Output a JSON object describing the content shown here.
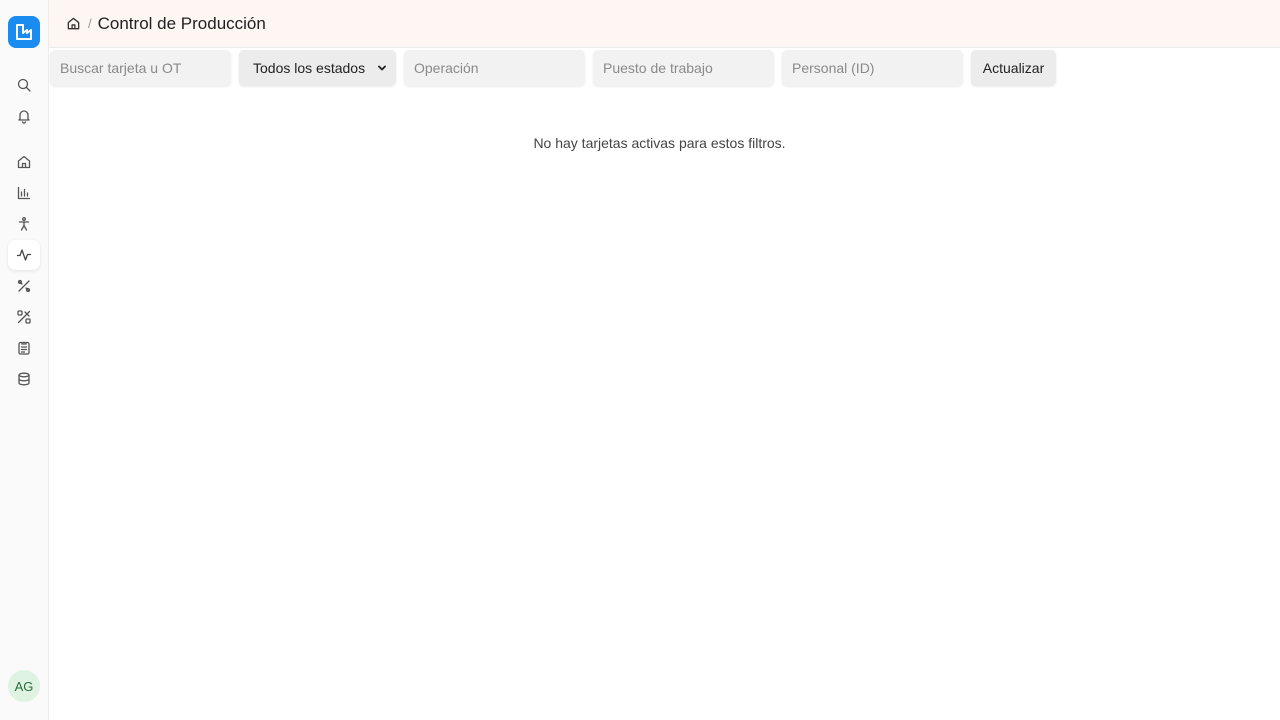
{
  "brand": {
    "accent": "#1a8cf0",
    "logo_icon": "factory-logo-icon"
  },
  "header": {
    "home_icon": "home-icon",
    "separator": "/",
    "title": "Control de Producción"
  },
  "sidebar": {
    "items": [
      {
        "name": "search",
        "icon": "search-icon"
      },
      {
        "name": "notifications",
        "icon": "bell-icon"
      },
      {
        "name": "home",
        "icon": "home-icon"
      },
      {
        "name": "reports",
        "icon": "bar-chart-icon"
      },
      {
        "name": "personnel",
        "icon": "person-icon"
      },
      {
        "name": "production-control",
        "icon": "activity-icon",
        "active": true
      },
      {
        "name": "tools",
        "icon": "tools-icon"
      },
      {
        "name": "maintenance",
        "icon": "wrench-pencil-icon"
      },
      {
        "name": "documents",
        "icon": "clipboard-list-icon"
      },
      {
        "name": "database",
        "icon": "database-icon"
      }
    ],
    "user_initials": "AG"
  },
  "filters": {
    "search_placeholder": "Buscar tarjeta u OT",
    "search_value": "",
    "status_selected": "Todos los estados",
    "operation_placeholder": "Operación",
    "workstation_placeholder": "Puesto de trabajo",
    "personnel_placeholder": "Personal (ID)",
    "refresh_label": "Actualizar"
  },
  "main": {
    "empty_message": "No hay tarjetas activas para estos filtros."
  }
}
